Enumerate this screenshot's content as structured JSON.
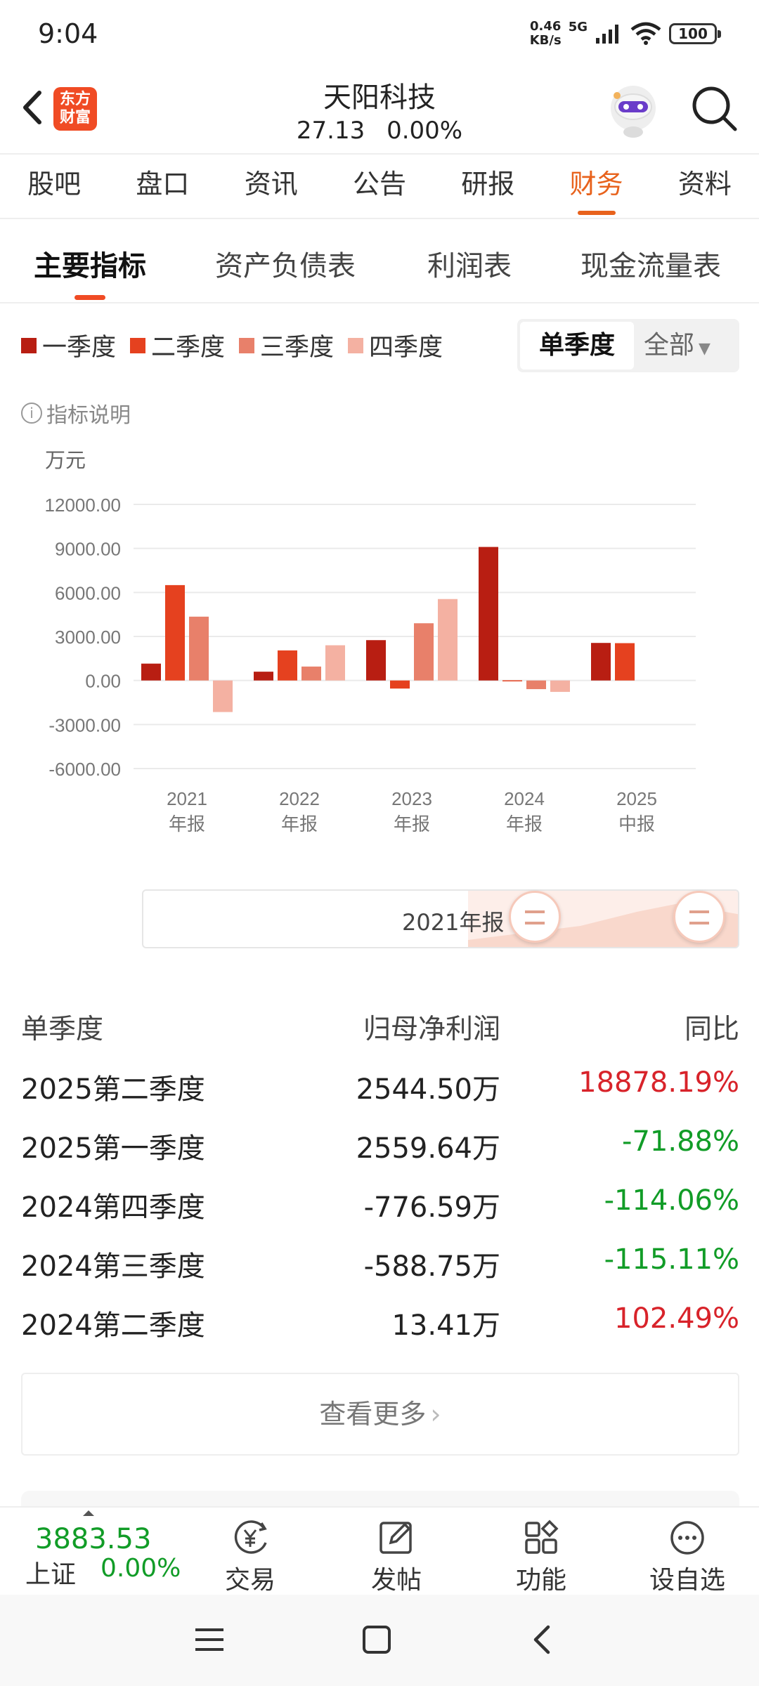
{
  "status_bar": {
    "time": "9:04",
    "net_speed": "0.46",
    "net_unit": "KB/s",
    "net_type": "5G",
    "battery": "100"
  },
  "header": {
    "logo_text": "东方财富",
    "stock_name": "天阳科技",
    "price": "27.13",
    "change": "0.00%"
  },
  "main_tabs": [
    "股吧",
    "盘口",
    "资讯",
    "公告",
    "研报",
    "财务",
    "资料"
  ],
  "main_tab_active": "财务",
  "sub_tabs": [
    "主要指标",
    "资产负债表",
    "利润表",
    "现金流量表"
  ],
  "legend": [
    {
      "label": "一季度",
      "color": "#b81e12"
    },
    {
      "label": "二季度",
      "color": "#e5411f"
    },
    {
      "label": "三季度",
      "color": "#e8806a"
    },
    {
      "label": "四季度",
      "color": "#f4b1a2"
    }
  ],
  "toggle": {
    "on": "单季度",
    "off": "全部"
  },
  "indicator_note": "指标说明",
  "unit": "万元",
  "chart_data": {
    "type": "bar",
    "categories": [
      [
        "2021",
        "年报"
      ],
      [
        "2022",
        "年报"
      ],
      [
        "2023",
        "年报"
      ],
      [
        "2024",
        "年报"
      ],
      [
        "2025",
        "中报"
      ]
    ],
    "series": [
      {
        "name": "一季度",
        "values": [
          1150,
          600,
          2750,
          9100,
          2559.64
        ]
      },
      {
        "name": "二季度",
        "values": [
          6500,
          2050,
          -550,
          13.41,
          2544.5
        ]
      },
      {
        "name": "三季度",
        "values": [
          4350,
          950,
          3900,
          -588.75,
          null
        ]
      },
      {
        "name": "四季度",
        "values": [
          -2150,
          2400,
          5550,
          -776.59,
          null
        ]
      }
    ],
    "yticks": [
      "12000.00",
      "9000.00",
      "6000.00",
      "3000.00",
      "0.00",
      "-3000.00",
      "-6000.00"
    ],
    "ylim": [
      -6000,
      12000
    ],
    "grid": true,
    "ylabel": "万元"
  },
  "range_slider": {
    "label": "2021年报"
  },
  "table": {
    "headers": [
      "单季度",
      "归母净利润",
      "同比"
    ],
    "rows": [
      {
        "period": "2025第二季度",
        "value": "2544.50万",
        "yoy": "18878.19%",
        "dir": "pos"
      },
      {
        "period": "2025第一季度",
        "value": "2559.64万",
        "yoy": "-71.88%",
        "dir": "neg"
      },
      {
        "period": "2024第四季度",
        "value": "-776.59万",
        "yoy": "-114.06%",
        "dir": "neg"
      },
      {
        "period": "2024第三季度",
        "value": "-588.75万",
        "yoy": "-115.11%",
        "dir": "neg"
      },
      {
        "period": "2024第二季度",
        "value": "13.41万",
        "yoy": "102.49%",
        "dir": "pos"
      }
    ]
  },
  "more_label": "查看更多",
  "bottom_bar": {
    "index_value": "3883.53",
    "index_name": "上证",
    "index_change": "0.00%",
    "trade": "交易",
    "post": "发帖",
    "function": "功能",
    "watchlist": "设自选"
  },
  "icons": {
    "back": "back-arrow-icon",
    "search": "search-icon",
    "trade": "yen-circle-icon",
    "post": "edit-icon",
    "function": "grid-icon",
    "watchlist": "more-circle-icon"
  }
}
